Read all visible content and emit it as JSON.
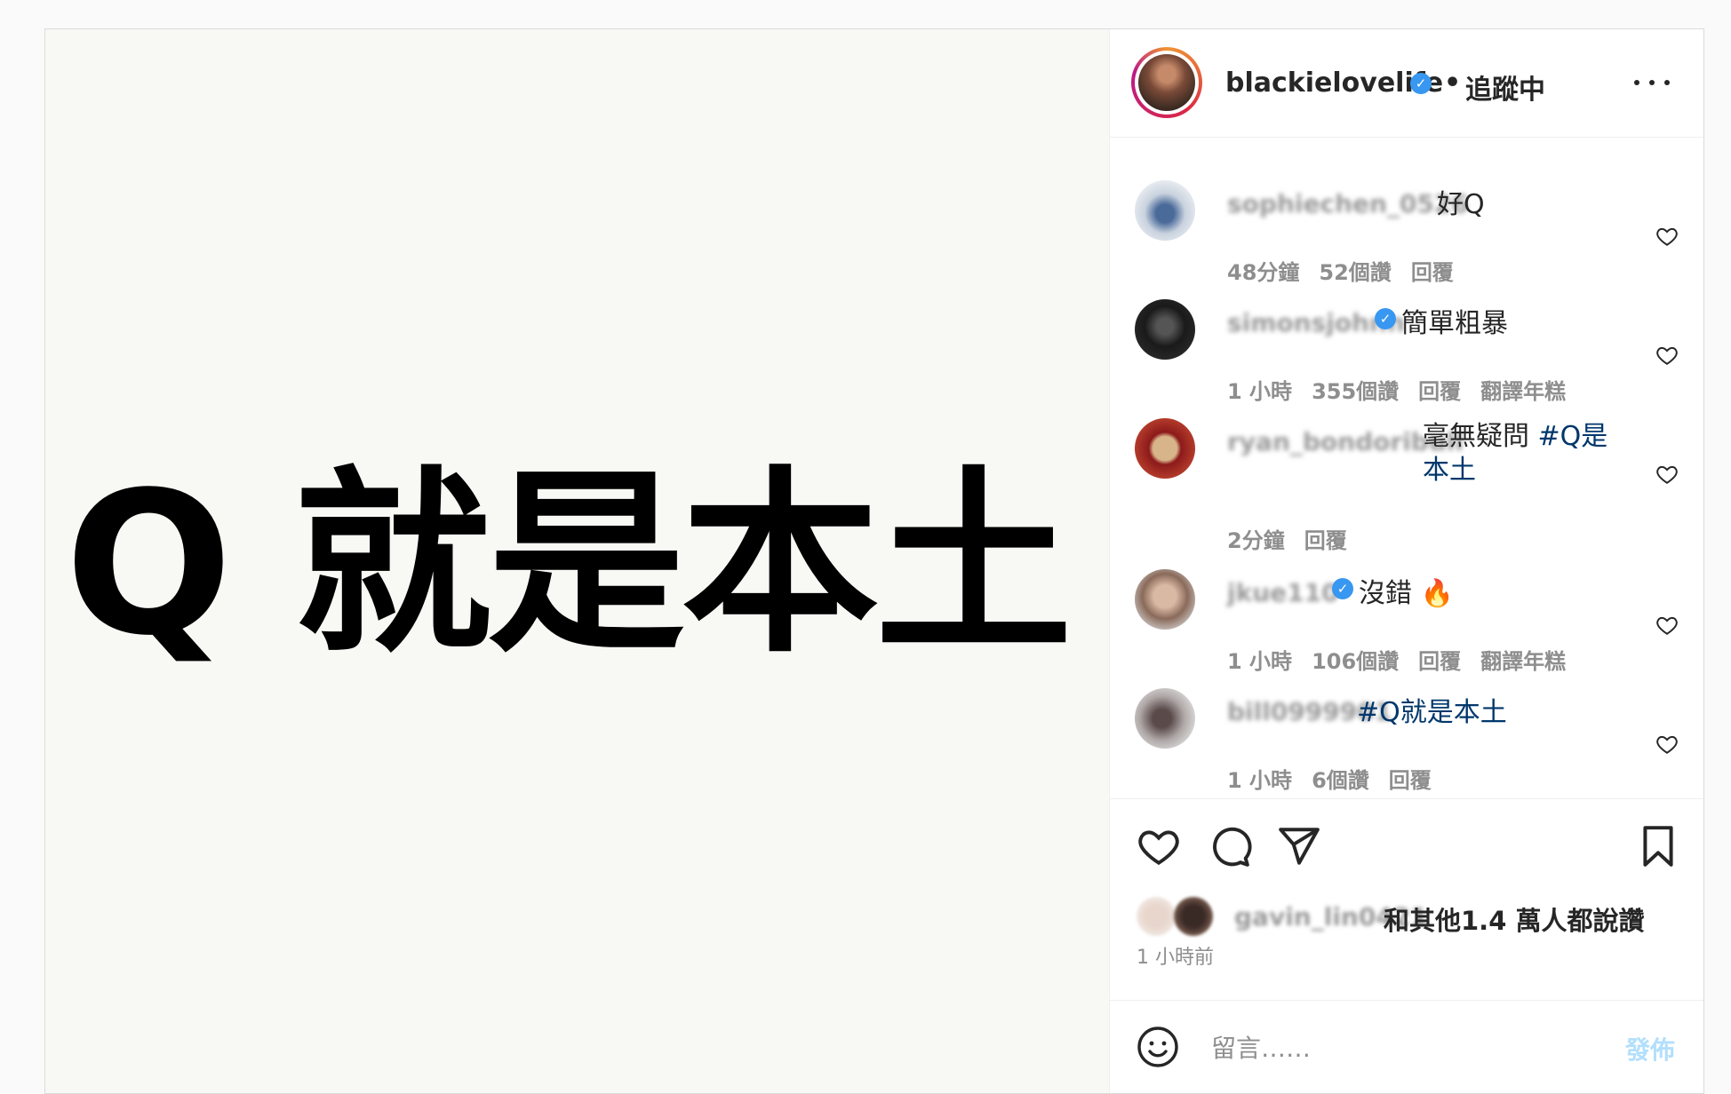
{
  "post": {
    "image_text": "Q 就是本土"
  },
  "header": {
    "username": "blackielovelife",
    "verified_icon": "verified-badge",
    "separator": "•",
    "follow_status": "追蹤中",
    "more_icon": "more-options-icon"
  },
  "comments": [
    {
      "username": "sophiechen_0526",
      "verified": false,
      "text": "好Q",
      "time": "48分鐘",
      "likes": "52個讚",
      "reply": "回覆",
      "translate": ""
    },
    {
      "username": "simonsjohnn",
      "verified": true,
      "text": "簡單粗暴",
      "time": "1 小時",
      "likes": "355個讚",
      "reply": "回覆",
      "translate": "翻譯年糕"
    },
    {
      "username": "ryan_bondoribull",
      "verified": false,
      "text": "毫無疑問 ",
      "tag": "#Q是本土",
      "time": "2分鐘",
      "likes": "",
      "reply": "回覆",
      "translate": ""
    },
    {
      "username": "jkue110",
      "verified": true,
      "text": "沒錯 🔥",
      "time": "1 小時",
      "likes": "106個讚",
      "reply": "回覆",
      "translate": "翻譯年糕"
    },
    {
      "username": "bill0999901",
      "verified": false,
      "text": "",
      "tag": "#Q就是本土",
      "time": "1 小時",
      "likes": "6個讚",
      "reply": "回覆",
      "translate": ""
    }
  ],
  "actions": {
    "like_icon": "heart-icon",
    "comment_icon": "comment-icon",
    "share_icon": "share-icon",
    "save_icon": "bookmark-icon"
  },
  "likes": {
    "first_liker": "gavin_lin0421",
    "summary": "和其他1.4 萬人都說讚",
    "time_ago": "1 小時前"
  },
  "add_comment": {
    "emoji_icon": "emoji-icon",
    "placeholder": "留言……",
    "post_label": "發佈"
  },
  "colors": {
    "link": "#00376b",
    "verified": "#3897f0",
    "muted": "#8e8e8e",
    "post_disabled": "#b2dffc"
  }
}
